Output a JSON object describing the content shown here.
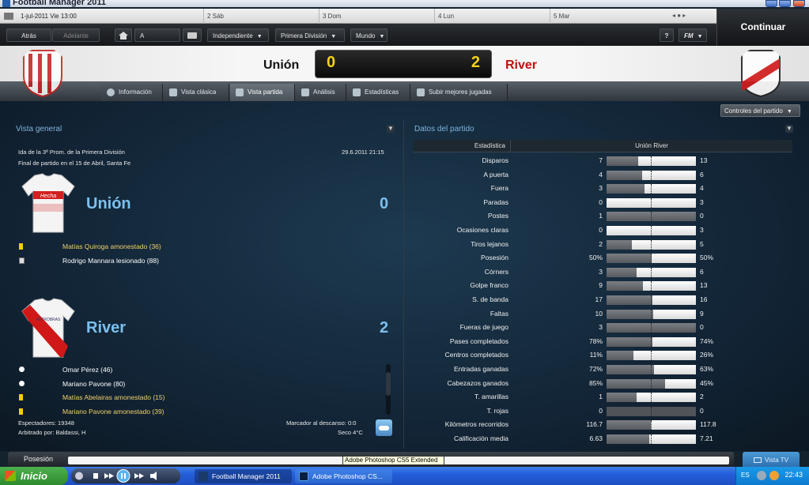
{
  "window": {
    "title": "Football Manager 2011"
  },
  "datebar": {
    "current": "1-jul-2011  Vie 13:00",
    "days": [
      "2 Sáb",
      "3 Dom",
      "4 Lun",
      "5 Mar"
    ]
  },
  "nav": {
    "back": "Atrás",
    "forward": "Adelante",
    "manager": "A Gallego",
    "team": "Independiente",
    "league": "Primera División",
    "world": "Mundo",
    "help": "?",
    "fm": "FM",
    "continue": "Continuar"
  },
  "header": {
    "home_team": "Unión",
    "away_team": "River",
    "home_score": "0",
    "away_score": "2"
  },
  "tabs": [
    {
      "label": "Información"
    },
    {
      "label": "Vista clásica"
    },
    {
      "label": "Vista partida"
    },
    {
      "label": "Análisis"
    },
    {
      "label": "Estadísticas"
    },
    {
      "label": "Subir mejores jugadas"
    }
  ],
  "controls": {
    "label": "Controles del partido"
  },
  "overview": {
    "title": "Vista general",
    "competition": "Ida de la 3ª Prom. de la Primera División",
    "datetime": "29.6.2011 21:15",
    "final_note": "Final de partido en el 15 de Abril, Santa Fe",
    "home": {
      "name": "Unión",
      "score": "0",
      "sponsor": "Hecha",
      "events": [
        {
          "type": "yellow",
          "text": "Matías Quiroga amonestado (36)"
        },
        {
          "type": "inj",
          "text": "Rodrigo Mannara lesionado (88)"
        }
      ]
    },
    "away": {
      "name": "River",
      "score": "2",
      "sponsor": "PETROBRAS",
      "events": [
        {
          "type": "goal",
          "text": "Omar Pérez (46)"
        },
        {
          "type": "goal",
          "text": "Mariano Pavone (80)"
        },
        {
          "type": "yellow",
          "text": "Matías Abelairas amonestado (15)"
        },
        {
          "type": "yellow",
          "text": "Mariano Pavone amonestado (39)"
        }
      ]
    },
    "spectators": "Espectadores: 19348",
    "referee": "Arbitrado por: Baldassi, H",
    "halftime": "Marcador al descanso: 0:0",
    "weather": "Seco 4°C"
  },
  "stats": {
    "title": "Datos del partido",
    "col_stat": "Estadística",
    "col_teams": "Unión  River",
    "rows": [
      {
        "label": "Disparos",
        "home": "7",
        "away": "13",
        "h": 7,
        "a": 13
      },
      {
        "label": "A puerta",
        "home": "4",
        "away": "6",
        "h": 4,
        "a": 6
      },
      {
        "label": "Fuera",
        "home": "3",
        "away": "4",
        "h": 3,
        "a": 4
      },
      {
        "label": "Paradas",
        "home": "0",
        "away": "3",
        "h": 0,
        "a": 3
      },
      {
        "label": "Postes",
        "home": "1",
        "away": "0",
        "h": 1,
        "a": 0
      },
      {
        "label": "Ocasiones claras",
        "home": "0",
        "away": "3",
        "h": 0,
        "a": 3
      },
      {
        "label": "Tiros lejanos",
        "home": "2",
        "away": "5",
        "h": 2,
        "a": 5
      },
      {
        "label": "Posesión",
        "home": "50%",
        "away": "50%",
        "h": 50,
        "a": 50
      },
      {
        "label": "Córners",
        "home": "3",
        "away": "6",
        "h": 3,
        "a": 6
      },
      {
        "label": "Golpe franco",
        "home": "9",
        "away": "13",
        "h": 9,
        "a": 13
      },
      {
        "label": "S. de banda",
        "home": "17",
        "away": "16",
        "h": 17,
        "a": 16
      },
      {
        "label": "Faltas",
        "home": "10",
        "away": "9",
        "h": 10,
        "a": 9
      },
      {
        "label": "Fueras de juego",
        "home": "3",
        "away": "0",
        "h": 3,
        "a": 0
      },
      {
        "label": "Pases completados",
        "home": "78%",
        "away": "74%",
        "h": 78,
        "a": 74
      },
      {
        "label": "Centros completados",
        "home": "11%",
        "away": "26%",
        "h": 11,
        "a": 26
      },
      {
        "label": "Entradas ganadas",
        "home": "72%",
        "away": "63%",
        "h": 72,
        "a": 63
      },
      {
        "label": "Cabezazos ganados",
        "home": "85%",
        "away": "45%",
        "h": 85,
        "a": 45
      },
      {
        "label": "T. amarillas",
        "home": "1",
        "away": "2",
        "h": 1,
        "a": 2
      },
      {
        "label": "T. rojas",
        "home": "0",
        "away": "0",
        "h": 0,
        "a": 0
      },
      {
        "label": "Kilómetros recorridos",
        "home": "116.7",
        "away": "117.8",
        "h": 116.7,
        "a": 117.8
      },
      {
        "label": "Calificación media",
        "home": "6.63",
        "away": "7.21",
        "h": 6.63,
        "a": 7.21
      }
    ]
  },
  "bottom": {
    "possession_label": "Posesión",
    "vista_tv": "Vista TV",
    "tooltip": "Adobe Photoshop CS5 Extended"
  },
  "taskbar": {
    "start": "Inicio",
    "items": [
      "Football Manager 2011",
      "Adobe Photoshop CS..."
    ],
    "lang": "ES",
    "clock": "22:43"
  },
  "colors": {
    "accent_blue": "#7cc0ee",
    "score_yellow": "#f0d21c",
    "away_red": "#c01010"
  }
}
